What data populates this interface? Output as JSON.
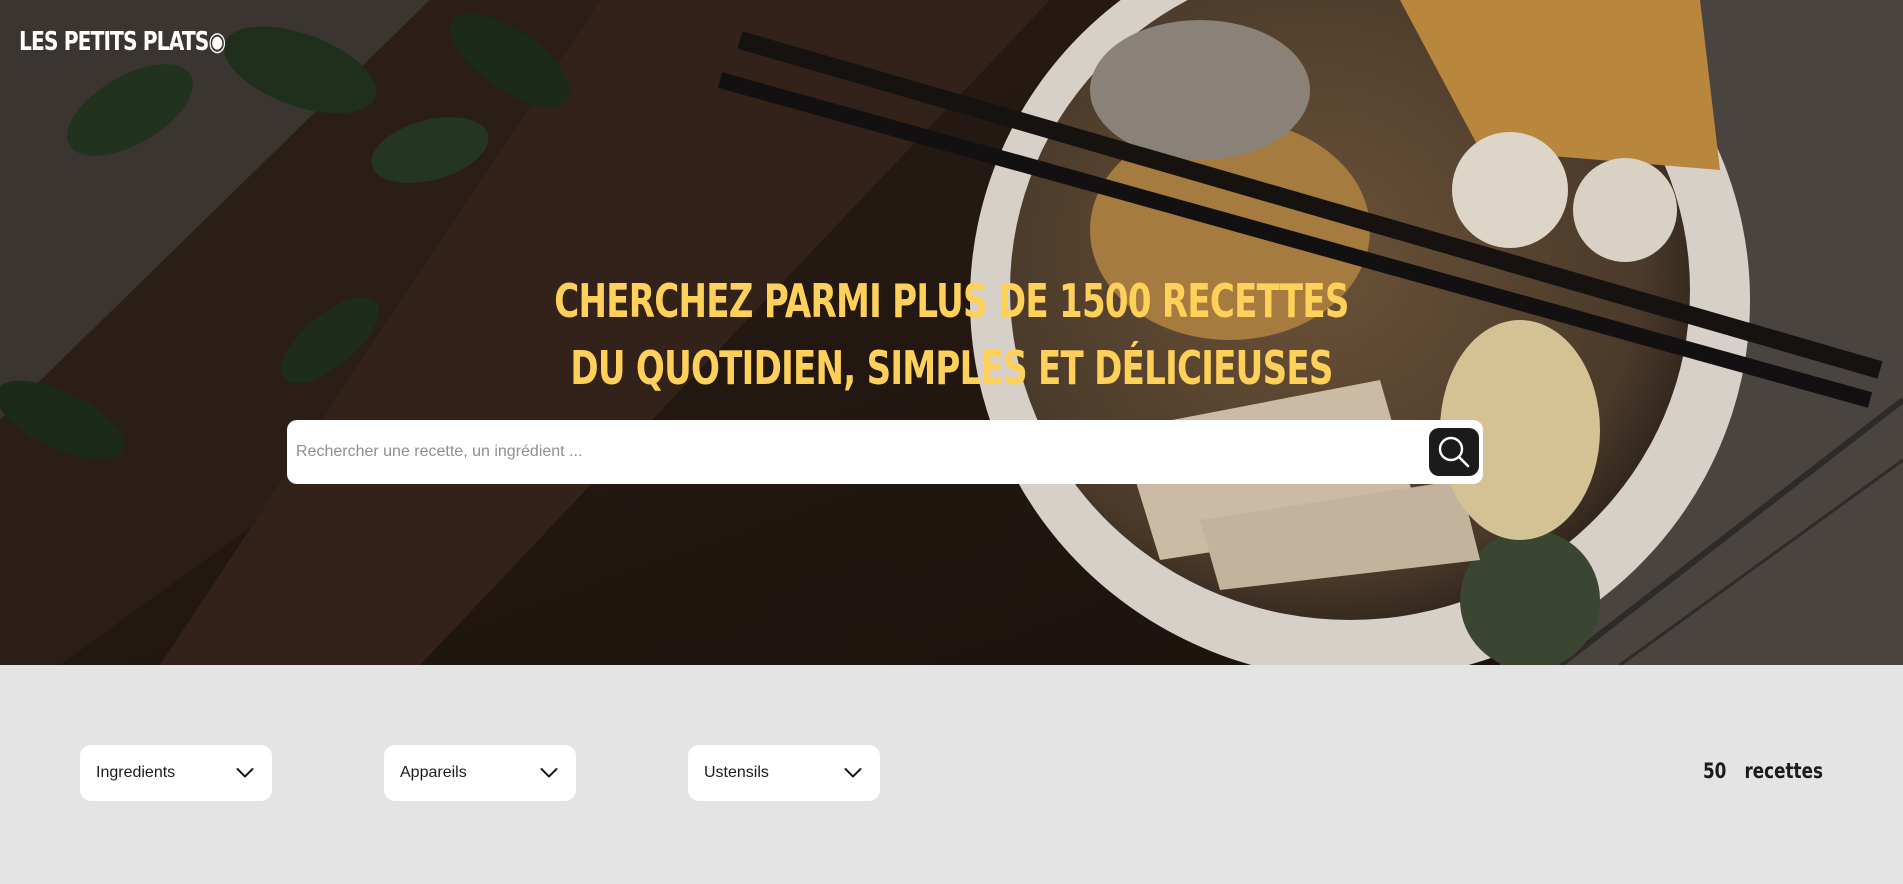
{
  "header": {
    "logo_text": "LES PETITS PLATS",
    "logo_mark": "◉",
    "headline_line1": "CHERCHEZ PARMI PLUS DE 1500 RECETTES",
    "headline_line2": "DU QUOTIDIEN, SIMPLES ET DÉLICIEUSES",
    "hero_image": "noodle-bowl-photo"
  },
  "search": {
    "placeholder": "Rechercher une recette, un ingrédient ...",
    "value": "",
    "button_icon": "search-icon"
  },
  "filters": {
    "ingredients_label": "Ingredients",
    "appliances_label": "Appareils",
    "utensils_label": "Ustensils",
    "chevron_icon": "chevron-down-icon"
  },
  "results": {
    "count_text": "50  recettes"
  },
  "colors": {
    "accent": "#FFD15B",
    "dark": "#1B1B1B",
    "background": "#E4E4E4",
    "white": "#FFFFFF"
  }
}
